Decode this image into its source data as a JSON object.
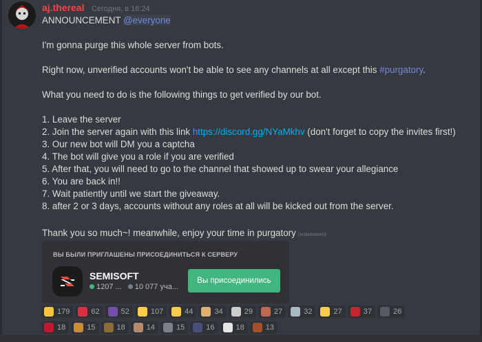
{
  "message": {
    "username": "aj.thereal",
    "timestamp": "Сегодня, в 16:24",
    "username_color": "#f04747",
    "announcement": "ANNOUNCEMENT",
    "mention": "@everyone",
    "para1": "I'm gonna purge this whole server from bots.",
    "para2_before": "Right now, unverified accounts won't be able to see any channels at all except this ",
    "para2_channel": "#purgatory",
    "para2_after": ".",
    "para3": "What you need to do is the following things to get verified by our bot.",
    "step1": "1. Leave the server",
    "step2_before": "2. Join the server again with this link ",
    "step2_link": "https://discord.gg/NYaMkhv",
    "step2_after": " (don't forget to copy the invites first!)",
    "step3": "3. Our new bot will DM you a captcha",
    "step4": "4. The bot will give you a role if you are verified",
    "step5": "5. After that, you will need to go to the channel that showed up to swear your allegiance",
    "step6": "6. You are back in!!",
    "step7": "7. Wait patiently until we start the giveaway.",
    "step8": "8. after 2 or 3 days, accounts without any roles at all will be kicked out from the server.",
    "closing": "Thank you so much~! meanwhile, enjoy your time in purgatory",
    "edited": "(изменено)"
  },
  "invite": {
    "header": "ВЫ БЫЛИ ПРИГЛАШЕНЫ ПРИСОЕДИНИТЬСЯ К СЕРВЕРУ",
    "server_name": "SEMISOFT",
    "online": "1207 ...",
    "members": "10 077 уча...",
    "join_label": "Вы присоединились",
    "online_color": "#43b581",
    "members_color": "#747f8d",
    "button_color": "#43b581"
  },
  "reactions": {
    "row1": [
      {
        "emoji": "sparkles-emoji",
        "color": "#f5c542",
        "count": "179"
      },
      {
        "emoji": "heart-emoji",
        "color": "#dd2e44",
        "count": "62"
      },
      {
        "emoji": "eggplant-emoji",
        "color": "#744eaa",
        "count": "52"
      },
      {
        "emoji": "thumbs-up-emoji",
        "color": "#ffcc4d",
        "count": "107"
      },
      {
        "emoji": "tired-face-emoji",
        "color": "#ffcc4d",
        "count": "44"
      },
      {
        "emoji": "bread-emoji",
        "color": "#e0b073",
        "count": "34"
      },
      {
        "emoji": "question-emoji",
        "color": "#cccccc",
        "count": "29"
      },
      {
        "emoji": "poop-emoji",
        "color": "#bf6952",
        "count": "27"
      },
      {
        "emoji": "alien-emoji",
        "color": "#aab8c2",
        "count": "32"
      },
      {
        "emoji": "crying-face-emoji",
        "color": "#ffcc4d",
        "count": "27"
      },
      {
        "emoji": "flag-emoji",
        "color": "#c1272d",
        "count": "37"
      },
      {
        "emoji": "custom-emoji-a",
        "color": "#555a63",
        "count": "26"
      }
    ],
    "row2": [
      {
        "emoji": "ogre-emoji",
        "color": "#be1931",
        "count": "18"
      },
      {
        "emoji": "custom-emoji-b",
        "color": "#c98c3a",
        "count": "15"
      },
      {
        "emoji": "custom-emoji-c",
        "color": "#8a6d3b",
        "count": "18"
      },
      {
        "emoji": "custom-emoji-d",
        "color": "#b58a6d",
        "count": "14"
      },
      {
        "emoji": "custom-emoji-e",
        "color": "#7a7f88",
        "count": "15"
      },
      {
        "emoji": "custom-emoji-f",
        "color": "#4a4f7a",
        "count": "16"
      },
      {
        "emoji": "custom-emoji-g",
        "color": "#e6e6e6",
        "count": "18"
      },
      {
        "emoji": "custom-emoji-h",
        "color": "#a0522d",
        "count": "13"
      }
    ]
  }
}
